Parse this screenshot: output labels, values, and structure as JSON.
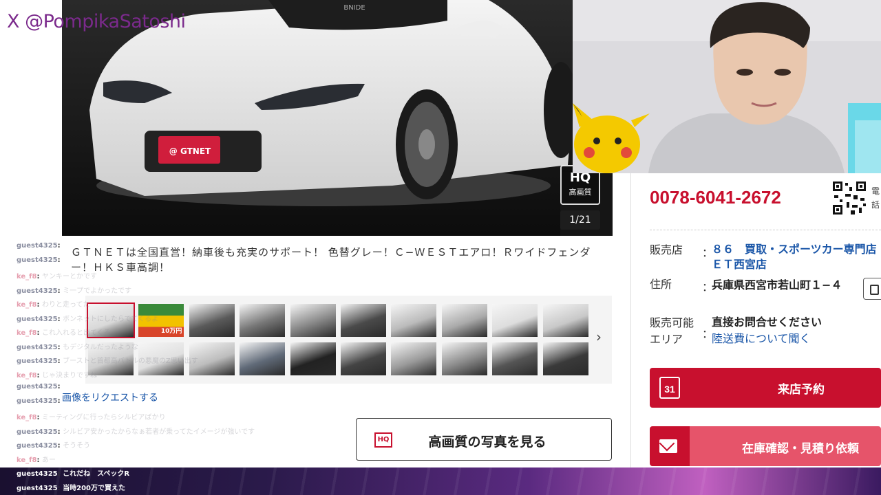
{
  "stream": {
    "handle": "X @PompikaSatoshi"
  },
  "photo": {
    "counter": "1/21",
    "hq_big": "HQ",
    "hq_small": "高画質",
    "plate_text": "@ GTNET",
    "brand_text": "BNIDE"
  },
  "description": "ＧＴＮＥＴは全国直営！納車後も充実のサポート！ 色替グレー！Ｃ−ＷＥＳＴエアロ！Ｒワイドフェンダー！ＨＫＳ車高調！",
  "thumbnails": {
    "row1": [
      "photo-1",
      "banner",
      "photo-3",
      "interior",
      "wheel",
      "photo-6",
      "photo-7",
      "rear",
      "photo-9",
      "exhaust"
    ],
    "row2": [
      "rear-2",
      "side",
      "photo-13",
      "engine",
      "gauge",
      "interior-2",
      "seat-1",
      "seat-2",
      "audio",
      "trunk"
    ],
    "banner_text": "10万円",
    "next_label": "›"
  },
  "links": {
    "request": "画像をリクエストする",
    "hq_button": "高画質の写真を見る",
    "hq_icon": "HQ"
  },
  "dealer": {
    "phone": "0078-6041-2672",
    "qr_text": "電話",
    "shop_label": "販売店",
    "shop_name": "８６　買取・スポーツカー専門店ＥＴ西宮店",
    "address_label": "住所",
    "address": "兵庫県西宮市若山町１−４",
    "area_label": "販売可能エリア",
    "area_value": "直接お問合せください",
    "shipping_link": "陸送費について聞く",
    "visit_button": "来店予約",
    "calendar_day": "31",
    "quote_button": "在庫確認・見積り依頼",
    "colon": "："
  },
  "chat": [
    {
      "user": "guest4325",
      "msg": "",
      "cls": ""
    },
    {
      "user": "guest4325",
      "msg": "",
      "cls": ""
    },
    {
      "user": "ke_f8",
      "msg": "ヤンキーとかです",
      "cls": "ke"
    },
    {
      "user": "guest4325",
      "msg": "ミ一プでよかったです",
      "cls": ""
    },
    {
      "user": "ke_f8",
      "msg": "わりと走ってた",
      "cls": "ke"
    },
    {
      "user": "guest4325",
      "msg": "ボンネットにしたらでてくるよ",
      "cls": ""
    },
    {
      "user": "ke_f8",
      "msg": "これ入れると出てくる",
      "cls": "ke"
    },
    {
      "user": "guest4325",
      "msg": "もデジタルだったような",
      "cls": ""
    },
    {
      "user": "guest4325",
      "msg": "ブーストと首都高バトルの悪魔のZ思い出す",
      "cls": ""
    },
    {
      "user": "ke_f8",
      "msg": "じゃ決まりですね",
      "cls": "ke"
    },
    {
      "user": "guest4325",
      "msg": "",
      "cls": ""
    },
    {
      "user": "guest4325",
      "msg": "",
      "cls": ""
    },
    {
      "user": "ke_f8",
      "msg": "ミーティングに行ったらシルビアばかり",
      "cls": "ke"
    },
    {
      "user": "guest4325",
      "msg": "シルビア安かったからなぁ若者が乗ってたイメージが強いです",
      "cls": ""
    },
    {
      "user": "guest4325",
      "msg": "そうそう",
      "cls": ""
    },
    {
      "user": "ke_f8",
      "msg": "あー",
      "cls": "ke"
    },
    {
      "user": "guest4325",
      "msg": "これだね　スペックR",
      "cls": "solid"
    },
    {
      "user": "guest4325",
      "msg": "当時200万で買えた",
      "cls": "solid"
    }
  ],
  "colors": {
    "brand_red": "#c8102e",
    "link_blue": "#1a56a8",
    "handle_purple": "#7b2a8c"
  }
}
